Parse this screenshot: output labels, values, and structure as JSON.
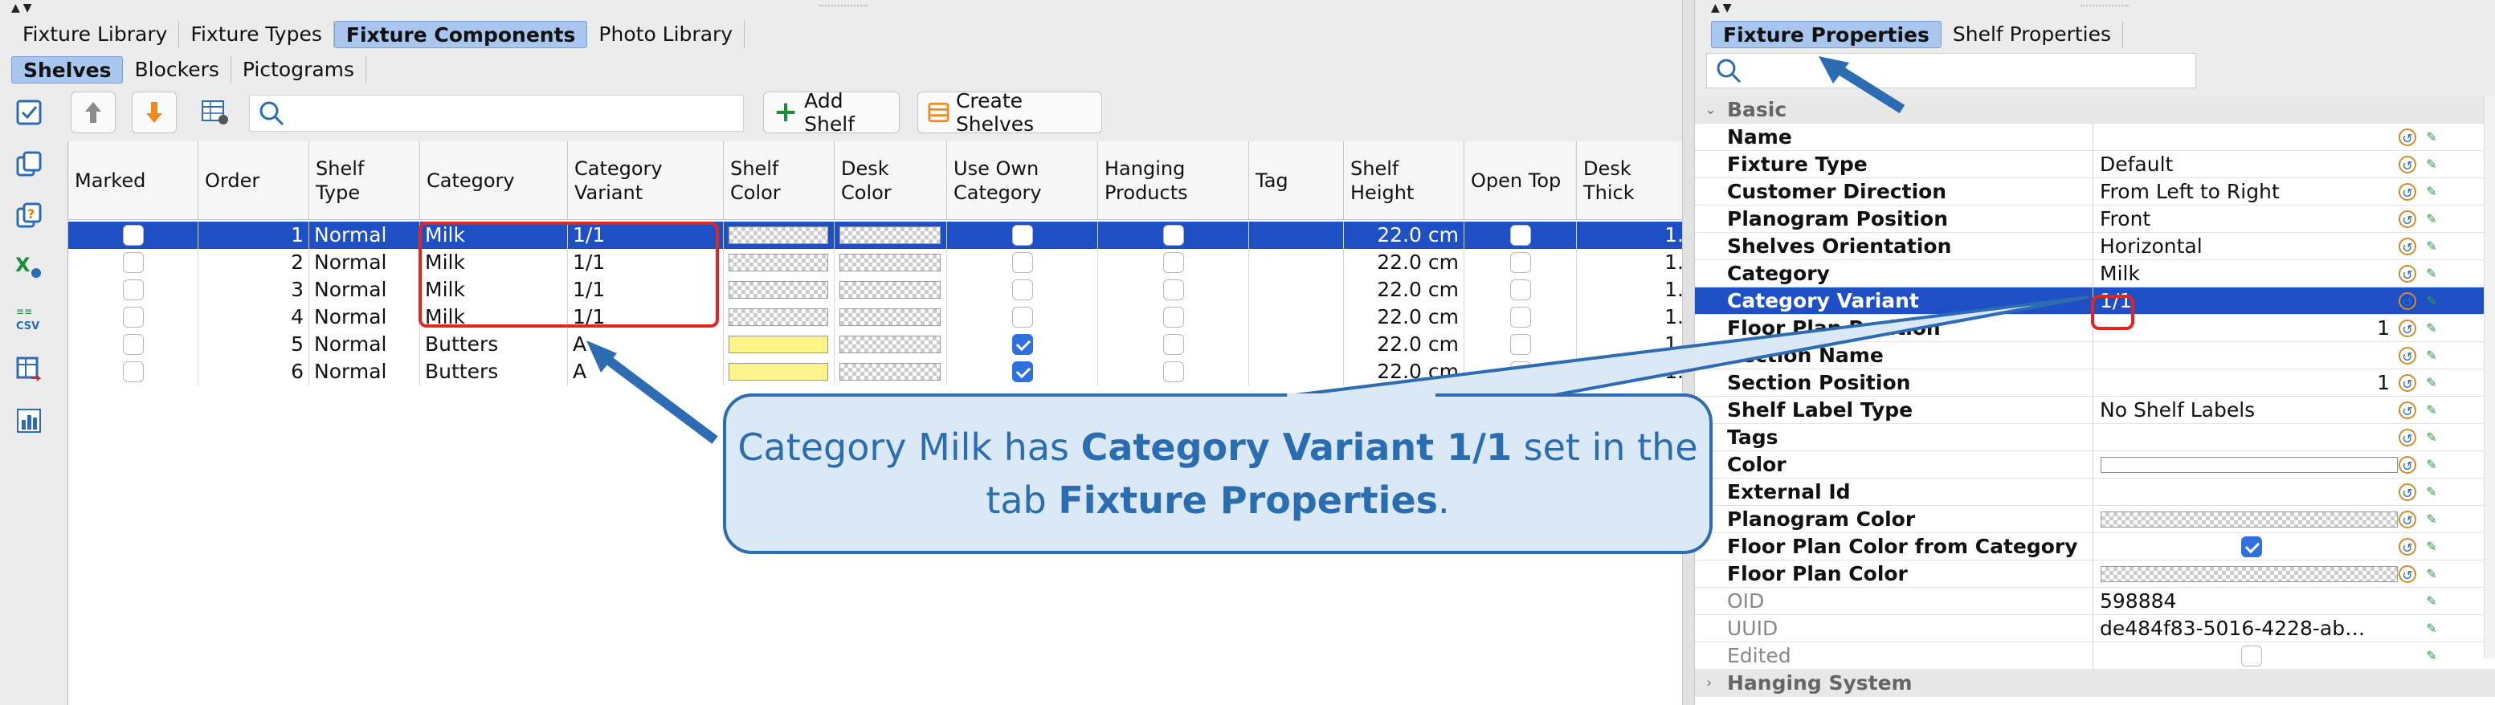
{
  "left": {
    "main_tabs": [
      "Fixture Library",
      "Fixture Types",
      "Fixture Components",
      "Photo Library"
    ],
    "main_tab_selected": 2,
    "sub_tabs": [
      "Shelves",
      "Blockers",
      "Pictograms"
    ],
    "sub_tab_selected": 0,
    "toolbar": {
      "add_shelf": "Add Shelf",
      "create_shelves": "Create Shelves",
      "search_value": ""
    },
    "columns": [
      "Marked",
      "Order",
      "Shelf Type",
      "Category",
      "Category Variant",
      "Shelf Color",
      "Desk Color",
      "Use Own Category",
      "Hanging Products",
      "Tag",
      "Shelf Height",
      "Open Top",
      "Desk Thick"
    ],
    "rows": [
      {
        "marked": false,
        "order": "1",
        "shelf_type": "Normal",
        "category": "Milk",
        "variant": "1/1",
        "shelf_color": "checker",
        "desk_color": "checker",
        "use_own": false,
        "hanging": false,
        "tag": "",
        "height": "22.0 cm",
        "open_top": false,
        "desk_thick": "1."
      },
      {
        "marked": false,
        "order": "2",
        "shelf_type": "Normal",
        "category": "Milk",
        "variant": "1/1",
        "shelf_color": "checker",
        "desk_color": "checker",
        "use_own": false,
        "hanging": false,
        "tag": "",
        "height": "22.0 cm",
        "open_top": false,
        "desk_thick": "1."
      },
      {
        "marked": false,
        "order": "3",
        "shelf_type": "Normal",
        "category": "Milk",
        "variant": "1/1",
        "shelf_color": "checker",
        "desk_color": "checker",
        "use_own": false,
        "hanging": false,
        "tag": "",
        "height": "22.0 cm",
        "open_top": false,
        "desk_thick": "1."
      },
      {
        "marked": false,
        "order": "4",
        "shelf_type": "Normal",
        "category": "Milk",
        "variant": "1/1",
        "shelf_color": "checker",
        "desk_color": "checker",
        "use_own": false,
        "hanging": false,
        "tag": "",
        "height": "22.0 cm",
        "open_top": false,
        "desk_thick": "1."
      },
      {
        "marked": false,
        "order": "5",
        "shelf_type": "Normal",
        "category": "Butters",
        "variant": "A",
        "shelf_color": "yellow",
        "desk_color": "checker",
        "use_own": true,
        "hanging": false,
        "tag": "",
        "height": "22.0 cm",
        "open_top": false,
        "desk_thick": "1."
      },
      {
        "marked": false,
        "order": "6",
        "shelf_type": "Normal",
        "category": "Butters",
        "variant": "A",
        "shelf_color": "yellow",
        "desk_color": "checker",
        "use_own": true,
        "hanging": false,
        "tag": "",
        "height": "22.0 cm",
        "open_top": false,
        "desk_thick": "1."
      }
    ],
    "selected_row": 0
  },
  "right": {
    "tabs": [
      "Fixture Properties",
      "Shelf Properties"
    ],
    "tab_selected": 0,
    "search_value": "",
    "group_basic": "Basic",
    "group_hanging": "Hanging System",
    "props": [
      {
        "label": "Name",
        "value": ""
      },
      {
        "label": "Fixture Type",
        "value": "Default"
      },
      {
        "label": "Customer Direction",
        "value": "From Left to Right"
      },
      {
        "label": "Planogram Position",
        "value": "Front"
      },
      {
        "label": "Shelves Orientation",
        "value": "Horizontal"
      },
      {
        "label": "Category",
        "value": "Milk"
      },
      {
        "label": "Category Variant",
        "value": "1/1"
      },
      {
        "label": "Floor Plan Position",
        "value": "1"
      },
      {
        "label": "Section Name",
        "value": ""
      },
      {
        "label": "Section Position",
        "value": "1"
      },
      {
        "label": "Shelf Label Type",
        "value": "No Shelf Labels"
      },
      {
        "label": "Tags",
        "value": ""
      },
      {
        "label": "Color",
        "value": ""
      },
      {
        "label": "External Id",
        "value": ""
      },
      {
        "label": "Planogram Color",
        "value": ""
      },
      {
        "label": "Floor Plan Color from Category",
        "value": ""
      },
      {
        "label": "Floor Plan Color",
        "value": ""
      },
      {
        "label": "OID",
        "value": "598884"
      },
      {
        "label": "UUID",
        "value": "de484f83-5016-4228-ab…"
      },
      {
        "label": "Edited",
        "value": ""
      }
    ],
    "selected_prop": 6
  },
  "callout": {
    "part1": "Category Milk has ",
    "bold1": "Category Variant 1/1",
    "part2": " set in the tab ",
    "bold2": "Fixture Properties",
    "part3": "."
  },
  "colors": {
    "selection": "#1f4fc4",
    "tab_selected": "#a8c6ee",
    "callout_border": "#2d6bb3",
    "callout_fill": "#dbe8f6",
    "highlight_red": "#e0261f",
    "swatch_yellow": "#fcf38a"
  }
}
